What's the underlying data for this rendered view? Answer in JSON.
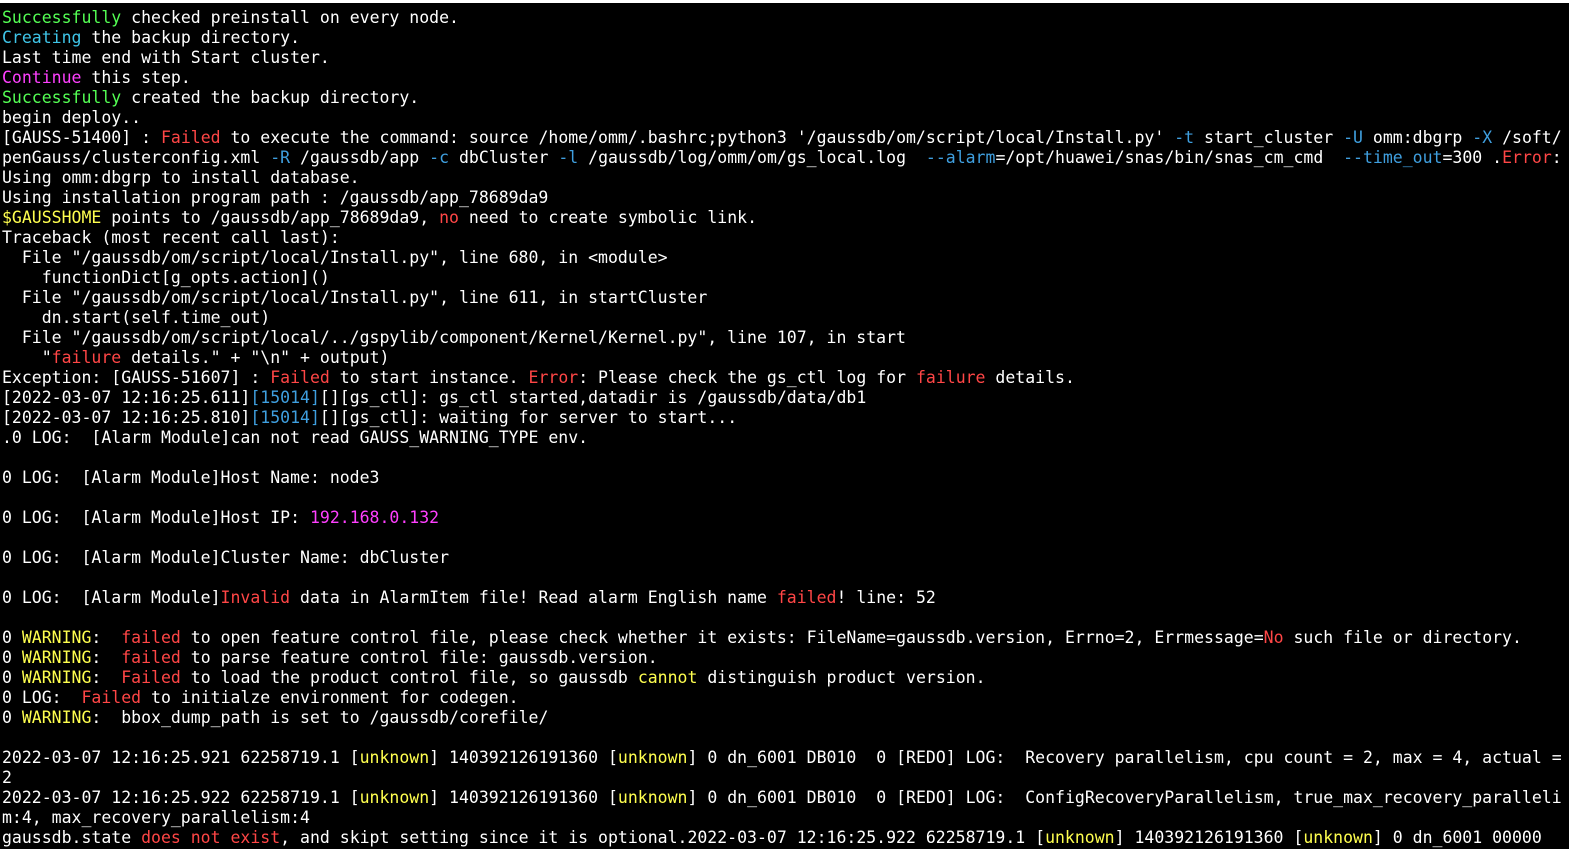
{
  "colors": {
    "background": "#000000",
    "default_text": "#ffffff",
    "green": "#54ff54",
    "cyan": "#3fc5e8",
    "magenta": "#ff40ff",
    "red": "#ff4646",
    "blue": "#3f9fdf",
    "yellow": "#ffff4f"
  },
  "lines": [
    [
      {
        "t": "Successfully",
        "c": "green"
      },
      {
        "t": " checked preinstall on every node.",
        "c": "white"
      }
    ],
    [
      {
        "t": "Creating",
        "c": "cyan"
      },
      {
        "t": " the backup directory.",
        "c": "white"
      }
    ],
    [
      {
        "t": "Last time end with Start cluster.",
        "c": "white"
      }
    ],
    [
      {
        "t": "Continue",
        "c": "magenta"
      },
      {
        "t": " this step.",
        "c": "white"
      }
    ],
    [
      {
        "t": "Successfully",
        "c": "green"
      },
      {
        "t": " created the backup directory.",
        "c": "white"
      }
    ],
    [
      {
        "t": "begin deploy..",
        "c": "white"
      }
    ],
    [
      {
        "t": "[GAUSS-51400] : ",
        "c": "white"
      },
      {
        "t": "Failed",
        "c": "red"
      },
      {
        "t": " to execute the command: source /home/omm/.bashrc;python3 '/gaussdb/om/script/local/Install.py' ",
        "c": "white"
      },
      {
        "t": "-t",
        "c": "blue"
      },
      {
        "t": " start_cluster ",
        "c": "white"
      },
      {
        "t": "-U",
        "c": "blue"
      },
      {
        "t": " omm:dbgrp ",
        "c": "white"
      },
      {
        "t": "-X",
        "c": "blue"
      },
      {
        "t": " /soft/",
        "c": "white"
      }
    ],
    [
      {
        "t": "penGauss/clusterconfig.xml ",
        "c": "white"
      },
      {
        "t": "-R",
        "c": "blue"
      },
      {
        "t": " /gaussdb/app ",
        "c": "white"
      },
      {
        "t": "-c",
        "c": "blue"
      },
      {
        "t": " dbCluster ",
        "c": "white"
      },
      {
        "t": "-l",
        "c": "blue"
      },
      {
        "t": " /gaussdb/log/omm/om/gs_local.log  ",
        "c": "white"
      },
      {
        "t": "--alarm",
        "c": "blue"
      },
      {
        "t": "=/opt/huawei/snas/bin/snas_cm_cmd  ",
        "c": "white"
      },
      {
        "t": "--time_out",
        "c": "blue"
      },
      {
        "t": "=300 .",
        "c": "white"
      },
      {
        "t": "Error",
        "c": "red"
      },
      {
        "t": ":",
        "c": "white"
      }
    ],
    [
      {
        "t": "Using omm:dbgrp to install database.",
        "c": "white"
      }
    ],
    [
      {
        "t": "Using installation program path : /gaussdb/app_78689da9",
        "c": "white"
      }
    ],
    [
      {
        "t": "$GAUSSHOME",
        "c": "yellow"
      },
      {
        "t": " points to /gaussdb/app_78689da9, ",
        "c": "white"
      },
      {
        "t": "no",
        "c": "red"
      },
      {
        "t": " need to create symbolic link.",
        "c": "white"
      }
    ],
    [
      {
        "t": "Traceback (most recent call last):",
        "c": "white"
      }
    ],
    [
      {
        "t": "  File \"/gaussdb/om/script/local/Install.py\", line 680, in <module>",
        "c": "white"
      }
    ],
    [
      {
        "t": "    functionDict[g_opts.action]()",
        "c": "white"
      }
    ],
    [
      {
        "t": "  File \"/gaussdb/om/script/local/Install.py\", line 611, in startCluster",
        "c": "white"
      }
    ],
    [
      {
        "t": "    dn.start(self.time_out)",
        "c": "white"
      }
    ],
    [
      {
        "t": "  File \"/gaussdb/om/script/local/../gspylib/component/Kernel/Kernel.py\", line 107, in start",
        "c": "white"
      }
    ],
    [
      {
        "t": "    \"",
        "c": "white"
      },
      {
        "t": "failure",
        "c": "red"
      },
      {
        "t": " details.\" + \"\\n\" + output)",
        "c": "white"
      }
    ],
    [
      {
        "t": "Exception: [GAUSS-51607] : ",
        "c": "white"
      },
      {
        "t": "Failed",
        "c": "red"
      },
      {
        "t": " to start instance. ",
        "c": "white"
      },
      {
        "t": "Error",
        "c": "red"
      },
      {
        "t": ": Please check the gs_ctl log for ",
        "c": "white"
      },
      {
        "t": "failure",
        "c": "red"
      },
      {
        "t": " details.",
        "c": "white"
      }
    ],
    [
      {
        "t": "[2022-03-07 12:16:25.611]",
        "c": "white"
      },
      {
        "t": "[15014]",
        "c": "blue"
      },
      {
        "t": "[][gs_ctl]: gs_ctl started,datadir is /gaussdb/data/db1",
        "c": "white"
      }
    ],
    [
      {
        "t": "[2022-03-07 12:16:25.810]",
        "c": "white"
      },
      {
        "t": "[15014]",
        "c": "blue"
      },
      {
        "t": "[][gs_ctl]: waiting for server to start...",
        "c": "white"
      }
    ],
    [
      {
        "t": ".0 LOG:  [Alarm Module]can not read GAUSS_WARNING_TYPE env.",
        "c": "white"
      }
    ],
    [],
    [
      {
        "t": "0 LOG:  [Alarm Module]Host Name: node3",
        "c": "white"
      }
    ],
    [],
    [
      {
        "t": "0 LOG:  [Alarm Module]Host IP: ",
        "c": "white"
      },
      {
        "t": "192.168.0.132",
        "c": "magenta"
      }
    ],
    [],
    [
      {
        "t": "0 LOG:  [Alarm Module]Cluster Name: dbCluster",
        "c": "white"
      }
    ],
    [],
    [
      {
        "t": "0 LOG:  [Alarm Module]",
        "c": "white"
      },
      {
        "t": "Invalid",
        "c": "red"
      },
      {
        "t": " data in AlarmItem file! Read alarm English name ",
        "c": "white"
      },
      {
        "t": "failed",
        "c": "red"
      },
      {
        "t": "! line: 52",
        "c": "white"
      }
    ],
    [],
    [
      {
        "t": "0 ",
        "c": "white"
      },
      {
        "t": "WARNING",
        "c": "yellow"
      },
      {
        "t": ":  ",
        "c": "white"
      },
      {
        "t": "failed",
        "c": "red"
      },
      {
        "t": " to open feature control file, please check whether it exists: FileName=gaussdb.version, Errno=2, Errmessage=",
        "c": "white"
      },
      {
        "t": "No",
        "c": "red"
      },
      {
        "t": " such file or directory.",
        "c": "white"
      }
    ],
    [
      {
        "t": "0 ",
        "c": "white"
      },
      {
        "t": "WARNING",
        "c": "yellow"
      },
      {
        "t": ":  ",
        "c": "white"
      },
      {
        "t": "failed",
        "c": "red"
      },
      {
        "t": " to parse feature control file: gaussdb.version.",
        "c": "white"
      }
    ],
    [
      {
        "t": "0 ",
        "c": "white"
      },
      {
        "t": "WARNING",
        "c": "yellow"
      },
      {
        "t": ":  ",
        "c": "white"
      },
      {
        "t": "Failed",
        "c": "red"
      },
      {
        "t": " to load the product control file, so gaussdb ",
        "c": "white"
      },
      {
        "t": "cannot",
        "c": "yellow"
      },
      {
        "t": " distinguish product version.",
        "c": "white"
      }
    ],
    [
      {
        "t": "0 LOG:  ",
        "c": "white"
      },
      {
        "t": "Failed",
        "c": "red"
      },
      {
        "t": " to initialze environment for codegen.",
        "c": "white"
      }
    ],
    [
      {
        "t": "0 ",
        "c": "white"
      },
      {
        "t": "WARNING",
        "c": "yellow"
      },
      {
        "t": ":  bbox_dump_path is set to /gaussdb/corefile/",
        "c": "white"
      }
    ],
    [],
    [
      {
        "t": "2022-03-07 12:16:25.921 62258719.1 [",
        "c": "white"
      },
      {
        "t": "unknown",
        "c": "yellow"
      },
      {
        "t": "] 140392126191360 [",
        "c": "white"
      },
      {
        "t": "unknown",
        "c": "yellow"
      },
      {
        "t": "] 0 dn_6001 DB010  0 [REDO] LOG:  Recovery parallelism, cpu count = 2, max = 4, actual =",
        "c": "white"
      }
    ],
    [
      {
        "t": "2",
        "c": "white"
      }
    ],
    [
      {
        "t": "2022-03-07 12:16:25.922 62258719.1 [",
        "c": "white"
      },
      {
        "t": "unknown",
        "c": "yellow"
      },
      {
        "t": "] 140392126191360 [",
        "c": "white"
      },
      {
        "t": "unknown",
        "c": "yellow"
      },
      {
        "t": "] 0 dn_6001 DB010  0 [REDO] LOG:  ConfigRecoveryParallelism, true_max_recovery_paralleli",
        "c": "white"
      }
    ],
    [
      {
        "t": "m:4, max_recovery_parallelism:4",
        "c": "white"
      }
    ],
    [
      {
        "t": "gaussdb.state ",
        "c": "white"
      },
      {
        "t": "does not exist",
        "c": "red"
      },
      {
        "t": ", and skipt setting since it is optional.2022-03-07 12:16:25.922 62258719.1 [",
        "c": "white"
      },
      {
        "t": "unknown",
        "c": "yellow"
      },
      {
        "t": "] 140392126191360 [",
        "c": "white"
      },
      {
        "t": "unknown",
        "c": "yellow"
      },
      {
        "t": "] 0 dn_6001 00000",
        "c": "white"
      }
    ]
  ]
}
